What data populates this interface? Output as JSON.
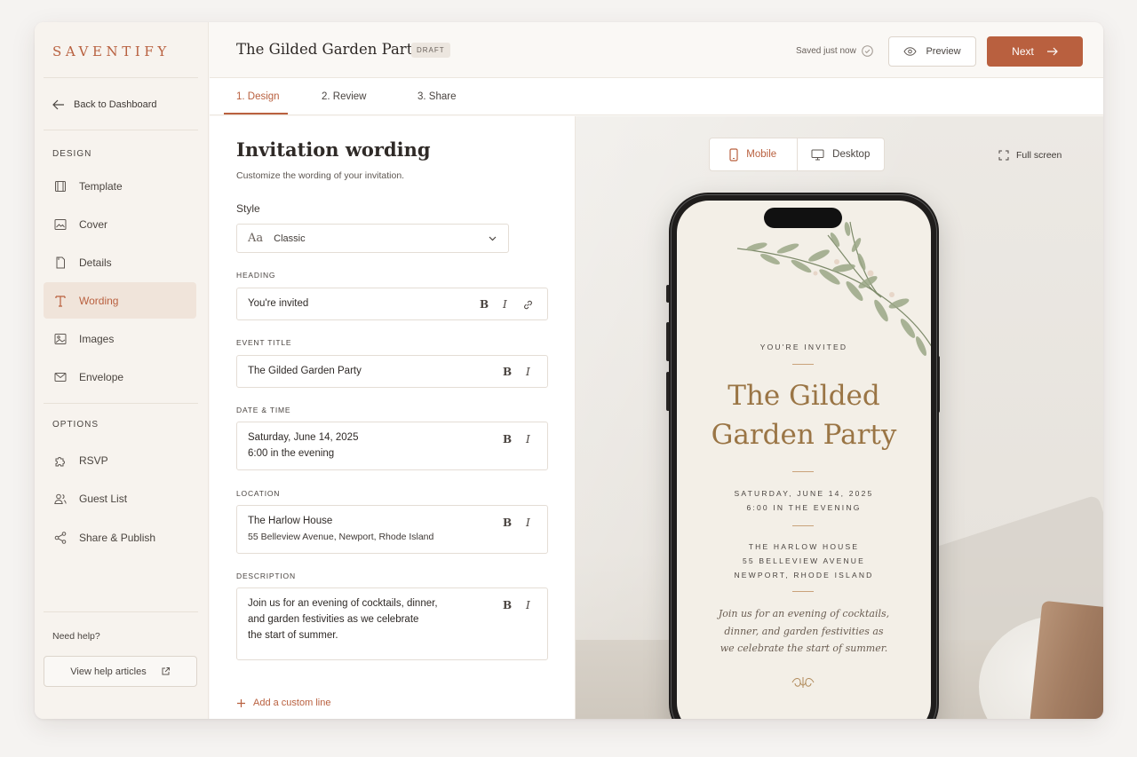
{
  "brand": {
    "logo": "SAVENTIFY",
    "accent": "#b9603f"
  },
  "sidebar": {
    "back_label": "Back to Dashboard",
    "design_section": "DESIGN",
    "design_items": [
      {
        "label": "Template",
        "icon": "template-icon"
      },
      {
        "label": "Cover",
        "icon": "image-frame-icon"
      },
      {
        "label": "Details",
        "icon": "document-icon"
      },
      {
        "label": "Wording",
        "icon": "text-t-icon",
        "active": true
      },
      {
        "label": "Images",
        "icon": "images-icon"
      },
      {
        "label": "Envelope",
        "icon": "envelope-icon"
      }
    ],
    "options_section": "OPTIONS",
    "option_items": [
      {
        "label": "RSVP",
        "icon": "puzzle-icon"
      },
      {
        "label": "Guest List",
        "icon": "guests-icon"
      },
      {
        "label": "Share & Publish",
        "icon": "share-icon"
      }
    ],
    "help_label": "Need help?",
    "help_button": "View help articles"
  },
  "header": {
    "title": "The Gilded Garden Party",
    "status_badge": "DRAFT",
    "saved_text": "Saved just now",
    "preview_label": "Preview",
    "next_label": "Next"
  },
  "tabs": [
    {
      "label": "1. Design",
      "active": true
    },
    {
      "label": "2. Review"
    },
    {
      "label": "3. Share"
    }
  ],
  "form": {
    "title": "Invitation wording",
    "subtitle": "Customize the wording of your invitation.",
    "style_label": "Style",
    "style_value": "Classic",
    "style_glyph": "Aa",
    "heading": {
      "label": "HEADING",
      "value": "You're invited"
    },
    "event_title": {
      "label": "EVENT TITLE",
      "value": "The Gilded Garden Party"
    },
    "date_time": {
      "label": "DATE & TIME",
      "line1": "Saturday, June 14, 2025",
      "line2": "6:00 in the evening"
    },
    "location": {
      "label": "LOCATION",
      "line1": "The Harlow House",
      "line2": "55 Belleview Avenue, Newport, Rhode Island"
    },
    "description": {
      "label": "DESCRIPTION",
      "line1": "Join us for an evening of cocktails, dinner,",
      "line2": "and garden festivities as we celebrate",
      "line3": "the start of summer."
    },
    "format": {
      "bold": "B",
      "italic": "I"
    },
    "add_line": "Add a custom line"
  },
  "preview": {
    "mobile_label": "Mobile",
    "desktop_label": "Desktop",
    "fullscreen_label": "Full screen",
    "invite": {
      "kicker": "YOU'RE INVITED",
      "title_line1": "The Gilded",
      "title_line2": "Garden Party",
      "date_line1": "SATURDAY, JUNE 14, 2025",
      "date_line2": "6:00 IN THE EVENING",
      "loc_line1": "THE HARLOW HOUSE",
      "loc_line2": "55 BELLEVIEW AVENUE",
      "loc_line3": "NEWPORT, RHODE ISLAND",
      "desc_line1": "Join us for an evening of cocktails,",
      "desc_line2": "dinner, and garden festivities as",
      "desc_line3": "we celebrate the start of summer."
    }
  }
}
